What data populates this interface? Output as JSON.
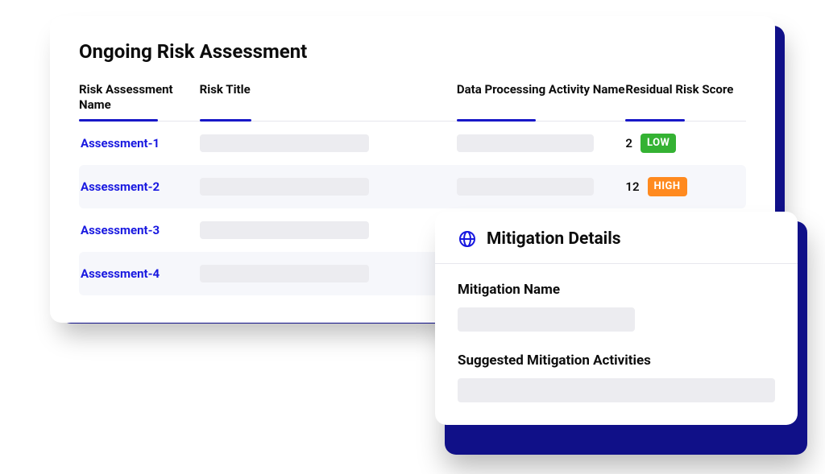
{
  "main": {
    "title": "Ongoing Risk Assessment",
    "columns": {
      "name": "Risk Assessment Name",
      "title": "Risk Title",
      "dpa": "Data Processing Activity Name",
      "score": "Residual Risk Score"
    },
    "rows": [
      {
        "name": "Assessment-1",
        "score": "2",
        "badge": "LOW"
      },
      {
        "name": "Assessment-2",
        "score": "12",
        "badge": "HIGH"
      },
      {
        "name": "Assessment-3",
        "score": "",
        "badge": ""
      },
      {
        "name": "Assessment-4",
        "score": "",
        "badge": ""
      }
    ]
  },
  "popover": {
    "title": "Mitigation Details",
    "field1_label": "Mitigation Name",
    "field2_label": "Suggested Mitigation Activities"
  },
  "colors": {
    "accent": "#1717c8",
    "low": "#34b233",
    "high": "#ff8a1f"
  }
}
